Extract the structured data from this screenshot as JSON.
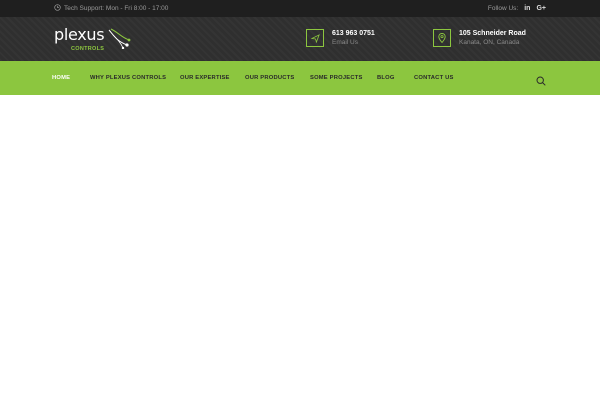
{
  "topbar": {
    "support_text": "Tech Support: Mon - Fri 8:00 - 17:00",
    "follow_label": "Follow Us:",
    "social": [
      "in",
      "G+"
    ]
  },
  "header": {
    "logo_word": "plexus",
    "logo_sub": "CONTROLS",
    "phone": "613 963 0751",
    "email_label": "Email Us",
    "address_line1": "105 Schneider Road",
    "address_line2": "Kanata, ON, Canada"
  },
  "nav": {
    "items": [
      "HOME",
      "WHY PLEXUS CONTROLS",
      "OUR EXPERTISE",
      "OUR PRODUCTS",
      "SOME PROJECTS",
      "BLOG",
      "CONTACT US"
    ]
  },
  "colors": {
    "accent": "#8cc63f",
    "header_bg": "#2f2f2f",
    "topbar_bg": "#1f1f1f"
  }
}
